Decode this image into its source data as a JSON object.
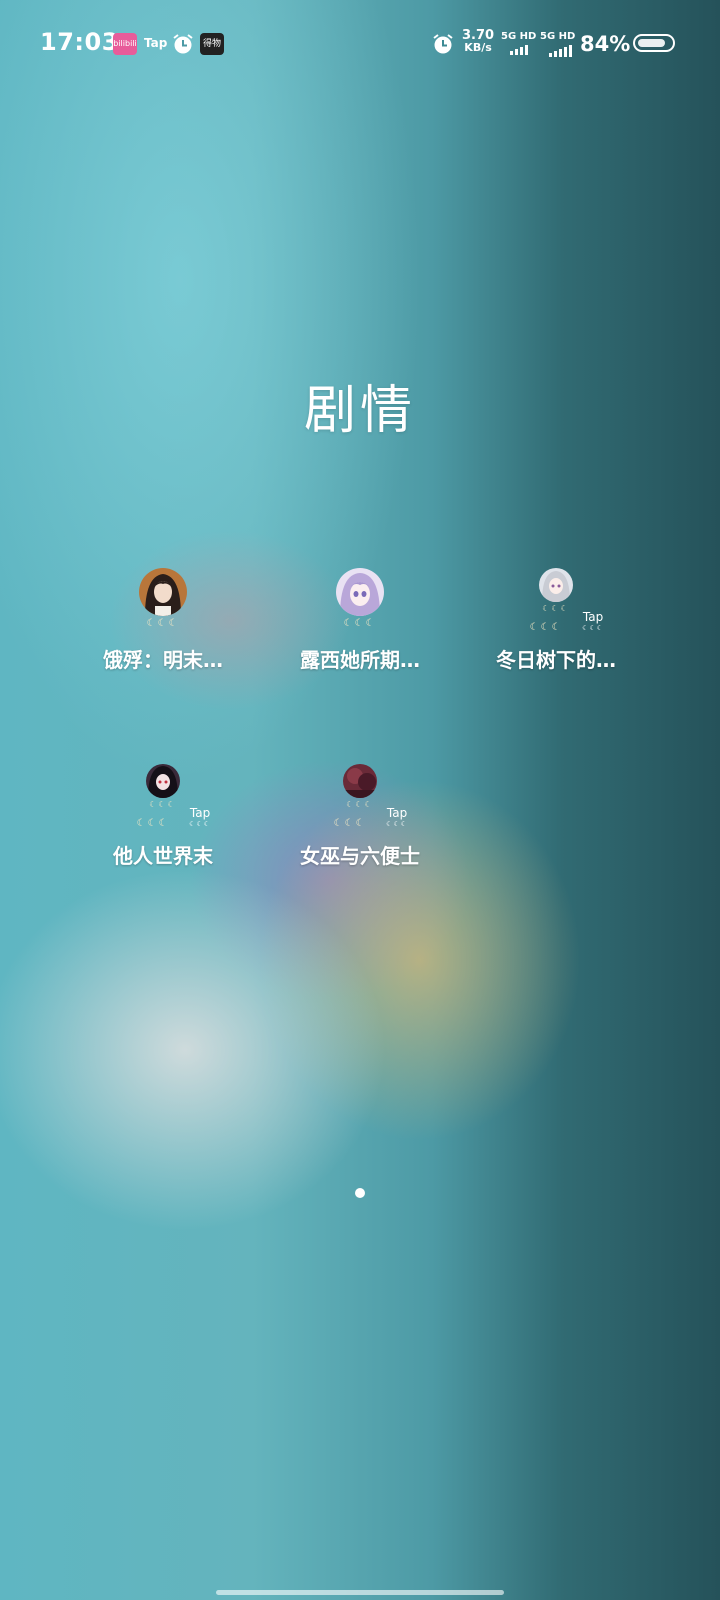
{
  "status_bar": {
    "time": "17:03",
    "notif_apps": [
      {
        "icon": "pink-app-icon",
        "label": "bilibili"
      },
      {
        "icon": "tap-app-icon",
        "label": "Tap"
      },
      {
        "icon": "alarm-icon"
      },
      {
        "icon": "dark-app-icon",
        "label": "得物"
      }
    ],
    "alarm_icon": "alarm-icon",
    "net_speed": "3.70",
    "net_unit": "KB/s",
    "sim1": "5G HD",
    "sim2": "5G HD",
    "battery_percent": "84%",
    "battery_level": 0.84
  },
  "folder": {
    "title": "剧情",
    "apps": [
      {
        "label": "饿殍：明末…",
        "icon": "anime-girl-dark-hair-avatar"
      },
      {
        "label": "露西她所期…",
        "icon": "anime-girl-purple-hair-avatar"
      },
      {
        "label": "冬日树下的…",
        "icon": "anime-girl-silver-hair-avatar",
        "badge": "Tap"
      },
      {
        "label": "他人世界末",
        "icon": "anime-girl-black-hair-avatar",
        "badge": "Tap"
      },
      {
        "label": "女巫与六便士",
        "icon": "witch-red-scene-avatar",
        "badge": "Tap"
      }
    ]
  },
  "colors": {
    "bg_left": "#5fb6c2",
    "bg_right": "#25525a",
    "moon": "#f3e7c4"
  }
}
